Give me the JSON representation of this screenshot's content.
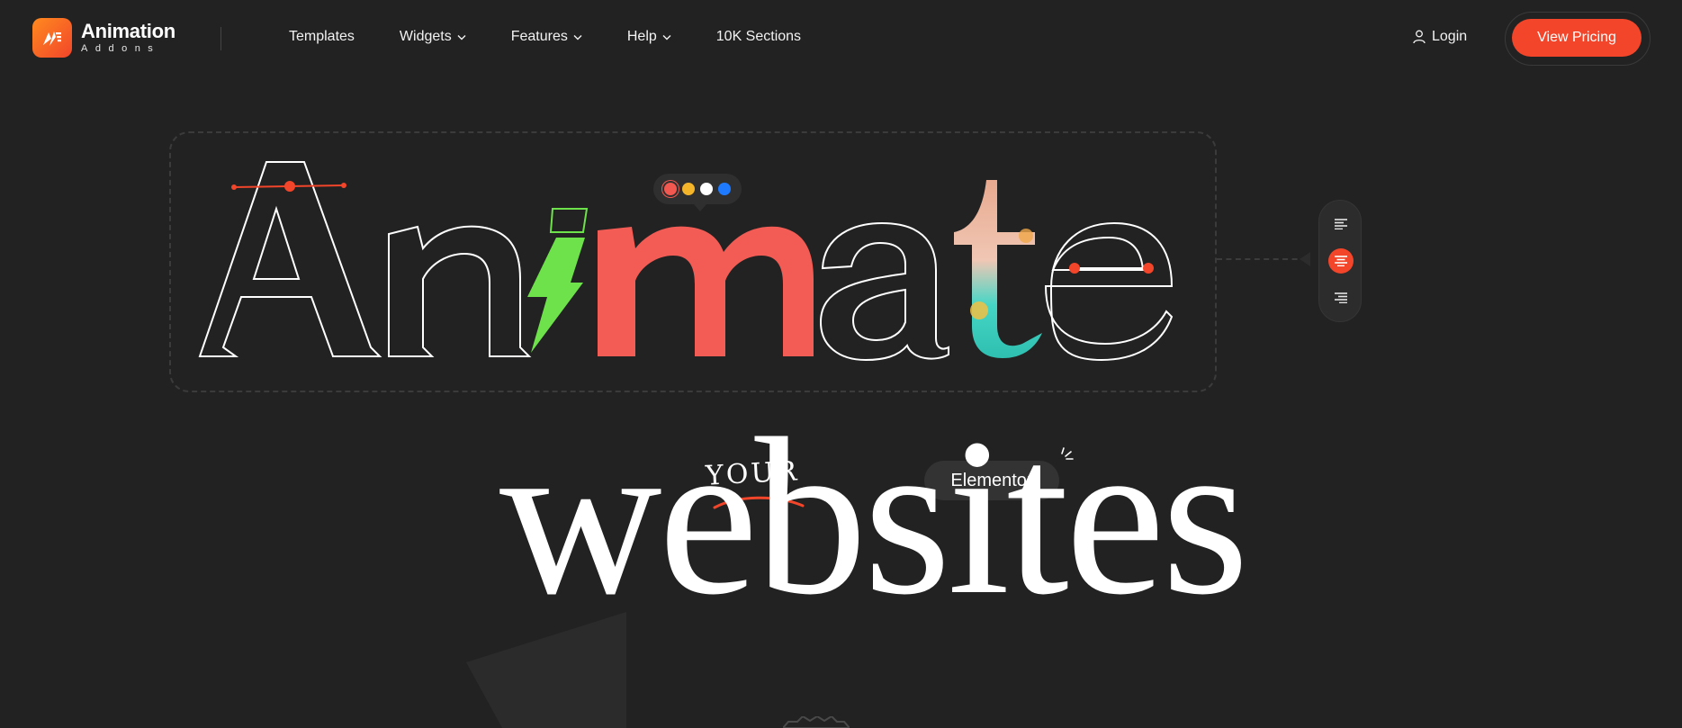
{
  "brand": {
    "name": "Animation",
    "subtitle": "Addons",
    "accent": "#f2452a"
  },
  "nav": {
    "items": [
      {
        "label": "Templates",
        "has_dropdown": false
      },
      {
        "label": "Widgets",
        "has_dropdown": true
      },
      {
        "label": "Features",
        "has_dropdown": true
      },
      {
        "label": "Help",
        "has_dropdown": true
      },
      {
        "label": "10K Sections",
        "has_dropdown": false
      }
    ],
    "login_label": "Login",
    "login_icon": "user-icon",
    "cta_label": "View Pricing"
  },
  "hero": {
    "headline": "Animate",
    "tagline_prefix": "YOUR",
    "tagline_badge": "Elementor",
    "tagline_word": "websites",
    "swatches": [
      "#f2584f",
      "#f5b52a",
      "#ffffff",
      "#1e7bff"
    ],
    "letter_colors": {
      "lightning_i": "#6ee24a",
      "m": "#f25c55",
      "t_gradient": [
        "#e8a98f",
        "#3ed9c8"
      ]
    },
    "align_options": [
      "align-left-icon",
      "align-center-icon",
      "align-right-icon"
    ],
    "align_selected": "align-center-icon"
  }
}
